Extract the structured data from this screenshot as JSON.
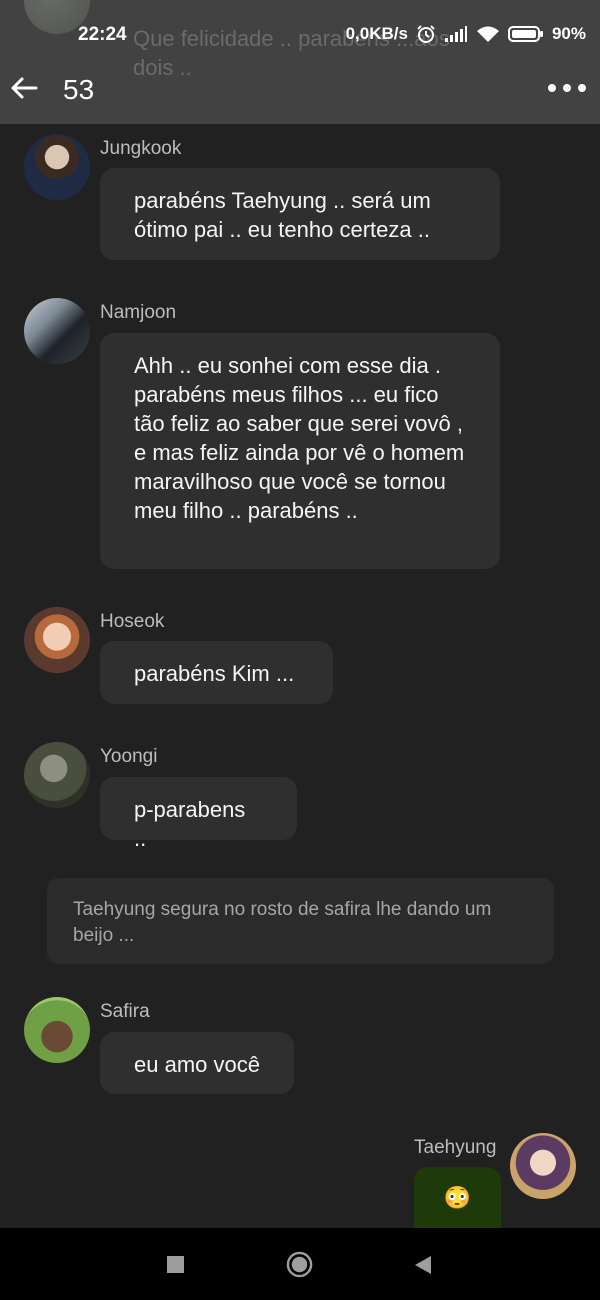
{
  "status_bar": {
    "time": "22:24",
    "net_speed": "0,0KB/s",
    "battery": "90%",
    "icons": [
      "alarm-icon",
      "signal-icon",
      "wifi-icon",
      "battery-icon"
    ]
  },
  "header": {
    "count": "53",
    "ghost_preview": "Que felicidade .. parabéns ...aos dois .."
  },
  "messages": [
    {
      "sender": "Jungkook",
      "text": "parabéns Taehyung .. será um ótimo pai .. eu tenho certeza .."
    },
    {
      "sender": "Namjoon",
      "text": "Ahh .. eu sonhei com esse dia . parabéns meus filhos ... eu fico tão feliz ao saber que serei vovô , e mas feliz ainda por vê o homem maravilhoso que você se tornou meu filho .. parabéns .."
    },
    {
      "sender": "Hoseok",
      "text": "parabéns Kim ..."
    },
    {
      "sender": "Yoongi",
      "text": "p-parabens .."
    },
    {
      "sender": "Safira",
      "text": "eu amo você"
    },
    {
      "sender": "Taehyung",
      "text": "😳"
    }
  ],
  "narration": "Taehyung segura no rosto de safira lhe dando um beijo ...",
  "colors": {
    "background": "#212121",
    "header": "#424242",
    "bubble": "#2f2f2f",
    "own_bubble": "#1d3a08"
  }
}
